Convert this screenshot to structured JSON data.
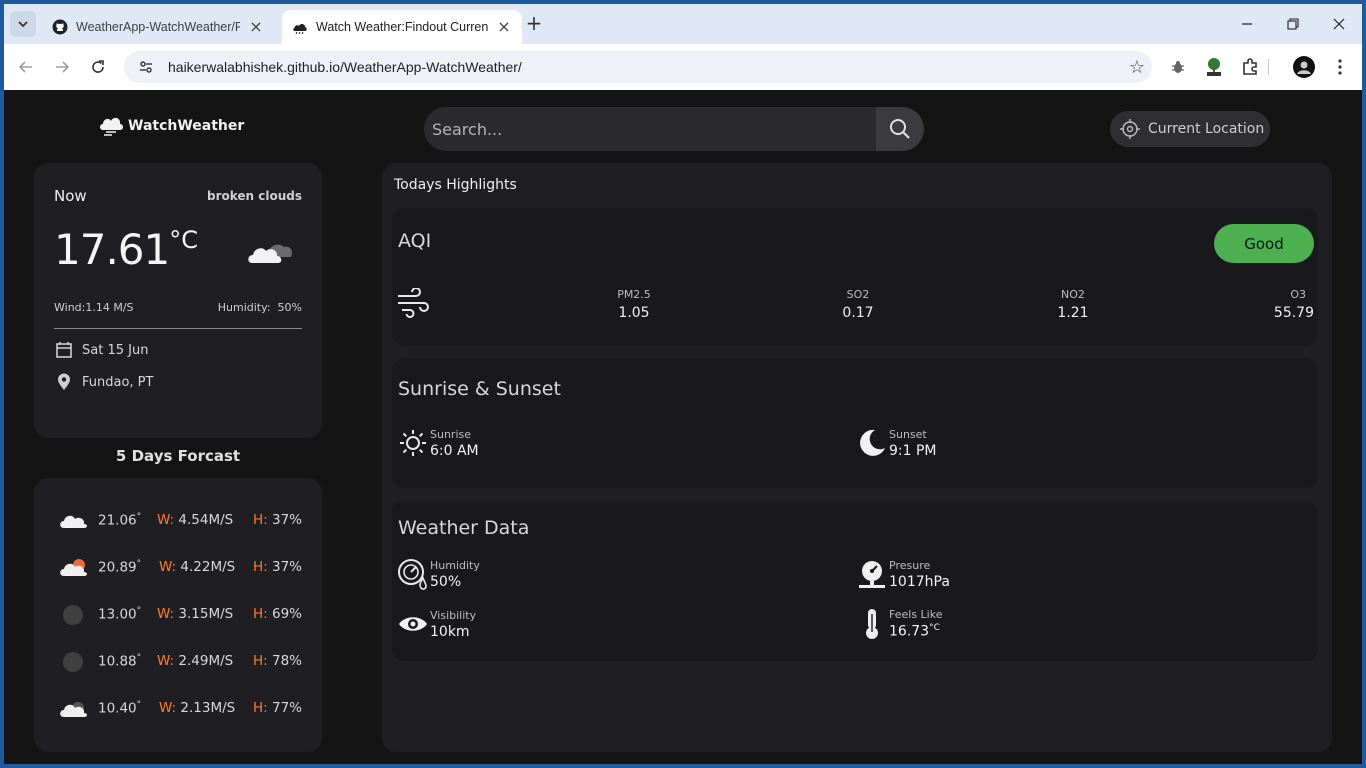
{
  "browser": {
    "tabs": [
      {
        "title": "WeatherApp-WatchWeather/RE",
        "active": false
      },
      {
        "title": "Watch Weather:Findout Current",
        "active": true
      }
    ],
    "url": "haikerwalabhishek.github.io/WeatherApp-WatchWeather/"
  },
  "app": {
    "logo_text": "WatchWeather",
    "search_placeholder": "Search...",
    "location_button": "Current Location"
  },
  "now": {
    "label": "Now",
    "description": "broken clouds",
    "temp": "17.61",
    "unit": "°C",
    "wind": "Wind:1.14 M/S",
    "humidity_label": "Humidity:",
    "humidity_value": "50%",
    "date": "Sat 15 Jun",
    "location": "Fundao, PT"
  },
  "forecast": {
    "title": "5 Days Forcast",
    "w_label": "W:",
    "h_label": "H:",
    "deg": "°",
    "items": [
      {
        "icon": "cloud-icon",
        "temp": "21.06",
        "wind": "4.54M/S",
        "hum": "37%"
      },
      {
        "icon": "cloud-sun-icon",
        "temp": "20.89",
        "wind": "4.22M/S",
        "hum": "37%"
      },
      {
        "icon": "dark-circle-icon",
        "temp": "13.00",
        "wind": "3.15M/S",
        "hum": "69%"
      },
      {
        "icon": "dark-circle-icon",
        "temp": "10.88",
        "wind": "2.49M/S",
        "hum": "78%"
      },
      {
        "icon": "cloud-dark-icon",
        "temp": "10.40",
        "wind": "2.13M/S",
        "hum": "77%"
      }
    ]
  },
  "highlights": {
    "title": "Todays Highlights",
    "aqi": {
      "title": "AQI",
      "status": "Good",
      "status_color": "#4caf50",
      "items": [
        {
          "key": "PM2.5",
          "value": "1.05"
        },
        {
          "key": "SO2",
          "value": "0.17"
        },
        {
          "key": "NO2",
          "value": "1.21"
        },
        {
          "key": "O3",
          "value": "55.79"
        }
      ]
    },
    "sun": {
      "title": "Sunrise & Sunset",
      "sunrise_label": "Sunrise",
      "sunrise_value": "6:0 AM",
      "sunset_label": "Sunset",
      "sunset_value": "9:1 PM"
    },
    "weather": {
      "title": "Weather Data",
      "humidity_label": "Humidity",
      "humidity_value": "50%",
      "pressure_label": "Presure",
      "pressure_value": "1017hPa",
      "visibility_label": "Visibility",
      "visibility_value": "10km",
      "feels_label": "Feels Like",
      "feels_value": "16.73",
      "feels_unit": "°C"
    }
  }
}
